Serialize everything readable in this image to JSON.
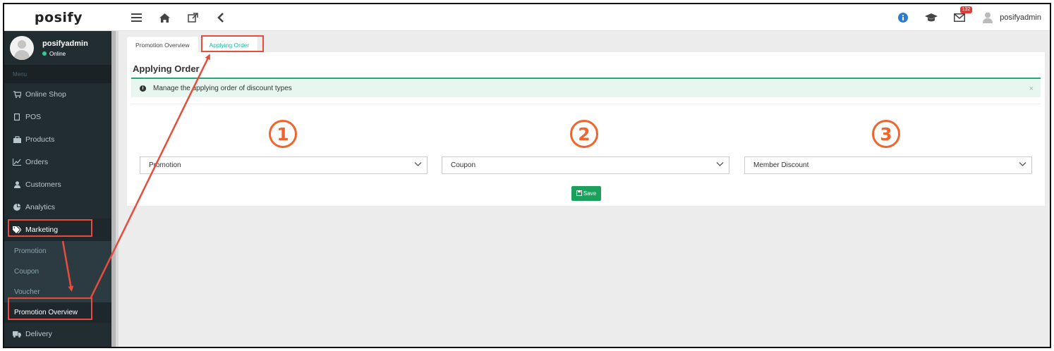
{
  "topbar": {
    "logo": "posify",
    "user_name": "posifyadmin",
    "mail_count": "132",
    "icons": [
      "menu-icon",
      "home-icon",
      "external-link-icon",
      "back-icon",
      "info-icon",
      "graduation-cap-icon",
      "mail-icon",
      "user-icon"
    ]
  },
  "sidebar": {
    "user": {
      "name": "posifyadmin",
      "status": "Online"
    },
    "menu_header": "Menu",
    "items": [
      {
        "label": "Online Shop",
        "icon": "cart-icon"
      },
      {
        "label": "POS",
        "icon": "tablet-icon"
      },
      {
        "label": "Products",
        "icon": "bag-icon"
      },
      {
        "label": "Orders",
        "icon": "chart-line-icon"
      },
      {
        "label": "Customers",
        "icon": "user-icon"
      },
      {
        "label": "Analytics",
        "icon": "pie-chart-icon"
      },
      {
        "label": "Marketing",
        "icon": "tags-icon"
      },
      {
        "label": "Delivery",
        "icon": "truck-icon"
      }
    ],
    "submenu": [
      "Promotion",
      "Coupon",
      "Voucher",
      "Promotion Overview"
    ]
  },
  "tabs": [
    "Promotion Overview",
    "Applying Order"
  ],
  "card": {
    "title": "Applying Order",
    "alert": "Manage the applying order of discount types",
    "alert_close": "×"
  },
  "order": [
    {
      "number": "1",
      "selected": "Promotion"
    },
    {
      "number": "2",
      "selected": "Coupon"
    },
    {
      "number": "3",
      "selected": "Member Discount"
    }
  ],
  "save_label": "Save",
  "colors": {
    "accent": "#1abc9c",
    "annotation": "#e74c3c",
    "number": "#f0642d",
    "save": "#1ba15b",
    "sidebar": "#222d32"
  }
}
